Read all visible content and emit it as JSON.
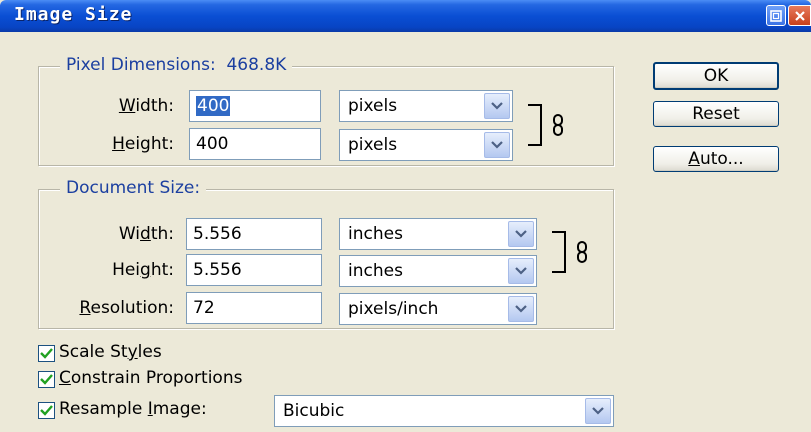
{
  "window": {
    "title": "Image Size"
  },
  "pixel_dimensions": {
    "legend": "Pixel Dimensions:",
    "size": "468.8K",
    "width": {
      "label_pre": "",
      "label_u": "W",
      "label_post": "idth:",
      "value": "400",
      "unit": "pixels"
    },
    "height": {
      "label_pre": "",
      "label_u": "H",
      "label_post": "eight:",
      "value": "400",
      "unit": "pixels"
    }
  },
  "document_size": {
    "legend": "Document Size:",
    "width": {
      "label_pre": "Wi",
      "label_u": "d",
      "label_post": "th:",
      "value": "5.556",
      "unit": "inches"
    },
    "height": {
      "label_pre": "Hei",
      "label_u": "g",
      "label_post": "ht:",
      "value": "5.556",
      "unit": "inches"
    },
    "resolution": {
      "label_pre": "",
      "label_u": "R",
      "label_post": "esolution:",
      "value": "72",
      "unit": "pixels/inch"
    }
  },
  "options": {
    "scale_styles": {
      "label_pre": "Scale St",
      "label_u": "y",
      "label_post": "les",
      "checked": true
    },
    "constrain": {
      "label_pre": "",
      "label_u": "C",
      "label_post": "onstrain Proportions",
      "checked": true
    },
    "resample": {
      "label_pre": "Resample ",
      "label_u": "I",
      "label_post": "mage:",
      "checked": true,
      "method": "Bicubic"
    }
  },
  "buttons": {
    "ok": "OK",
    "reset": "Reset",
    "auto_u": "A",
    "auto_rest": "uto..."
  },
  "colors": {
    "title_bar": "#0a4fd4",
    "legend_text": "#1b3fa0",
    "selection": "#316ac5",
    "face": "#ece9d8"
  }
}
